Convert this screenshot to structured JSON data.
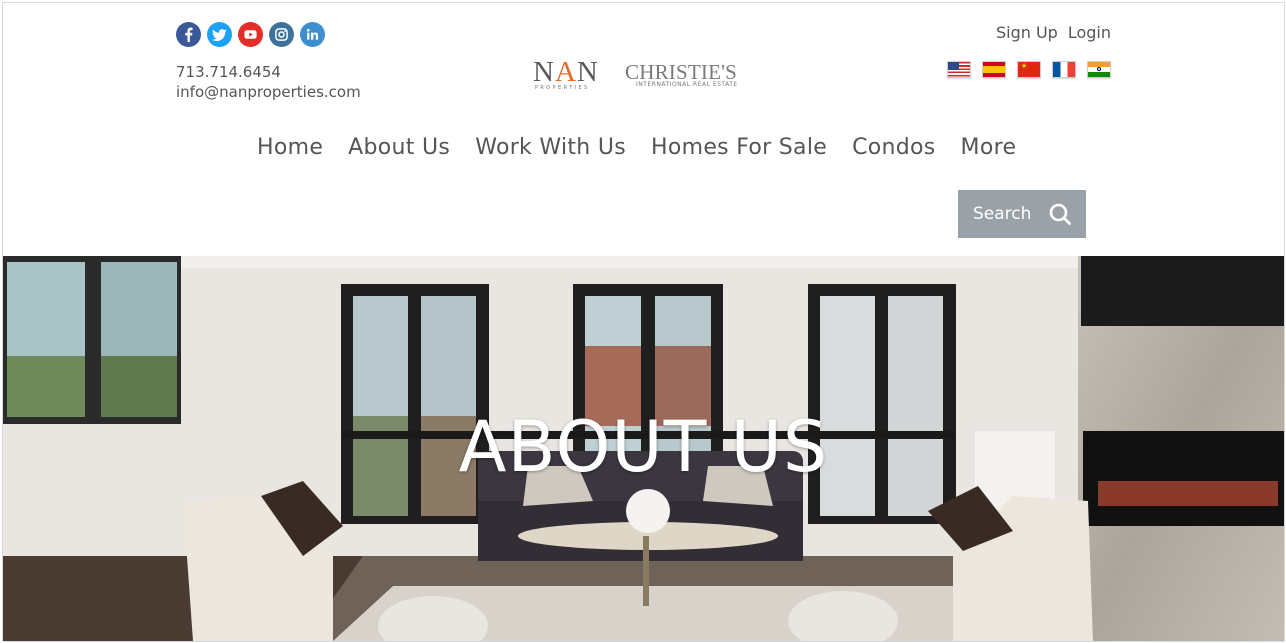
{
  "social": {
    "facebook": {
      "icon": "facebook-icon",
      "color": "#3b5998"
    },
    "twitter": {
      "icon": "twitter-icon",
      "color": "#1da1f2"
    },
    "youtube": {
      "icon": "youtube-icon",
      "color": "#e52d27"
    },
    "instagram": {
      "icon": "instagram-icon",
      "color": "#3f729b"
    },
    "linkedin": {
      "icon": "linkedin-icon",
      "color": "#3d8fd1"
    }
  },
  "contact": {
    "phone": "713.714.6454",
    "email": "info@nanproperties.com"
  },
  "auth": {
    "signup_label": "Sign Up",
    "login_label": "Login"
  },
  "flags": [
    "united-states",
    "spain",
    "china",
    "france",
    "india"
  ],
  "logo": {
    "nan": "NAN",
    "nan_sub": "PROPERTIES",
    "christies": "CHRISTIE'S",
    "christies_sub": "INTERNATIONAL REAL ESTATE"
  },
  "nav": {
    "items": [
      {
        "label": "Home"
      },
      {
        "label": "About Us"
      },
      {
        "label": "Work With Us"
      },
      {
        "label": "Homes For Sale"
      },
      {
        "label": "Condos"
      },
      {
        "label": "More"
      }
    ]
  },
  "search": {
    "label": "Search",
    "background": "#9aa2a7"
  },
  "hero": {
    "title": "ABOUT US"
  }
}
